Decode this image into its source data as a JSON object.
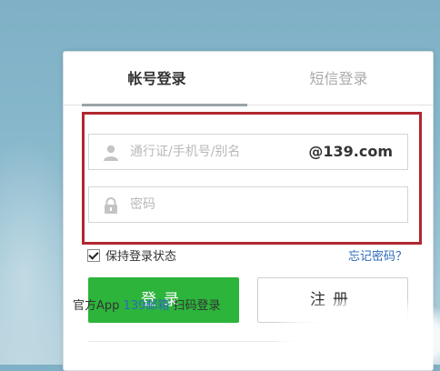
{
  "tabs": {
    "account": "帐号登录",
    "sms": "短信登录"
  },
  "username_field": {
    "placeholder": "通行证/手机号/别名",
    "domain": "@139.com",
    "icon": "user-icon"
  },
  "password_field": {
    "placeholder": "密码",
    "icon": "lock-icon"
  },
  "remember": {
    "label": "保持登录状态",
    "checked": true
  },
  "forgot_label": "忘记密码？",
  "login_label": "登录",
  "register_label": "注册",
  "app_row": {
    "prefix": "官方App",
    "link": "139邮箱",
    "suffix": "扫码登录"
  },
  "colors": {
    "accent_green": "#2cb43b",
    "highlight_red": "#b0282f",
    "link_blue": "#2e6bb8"
  }
}
